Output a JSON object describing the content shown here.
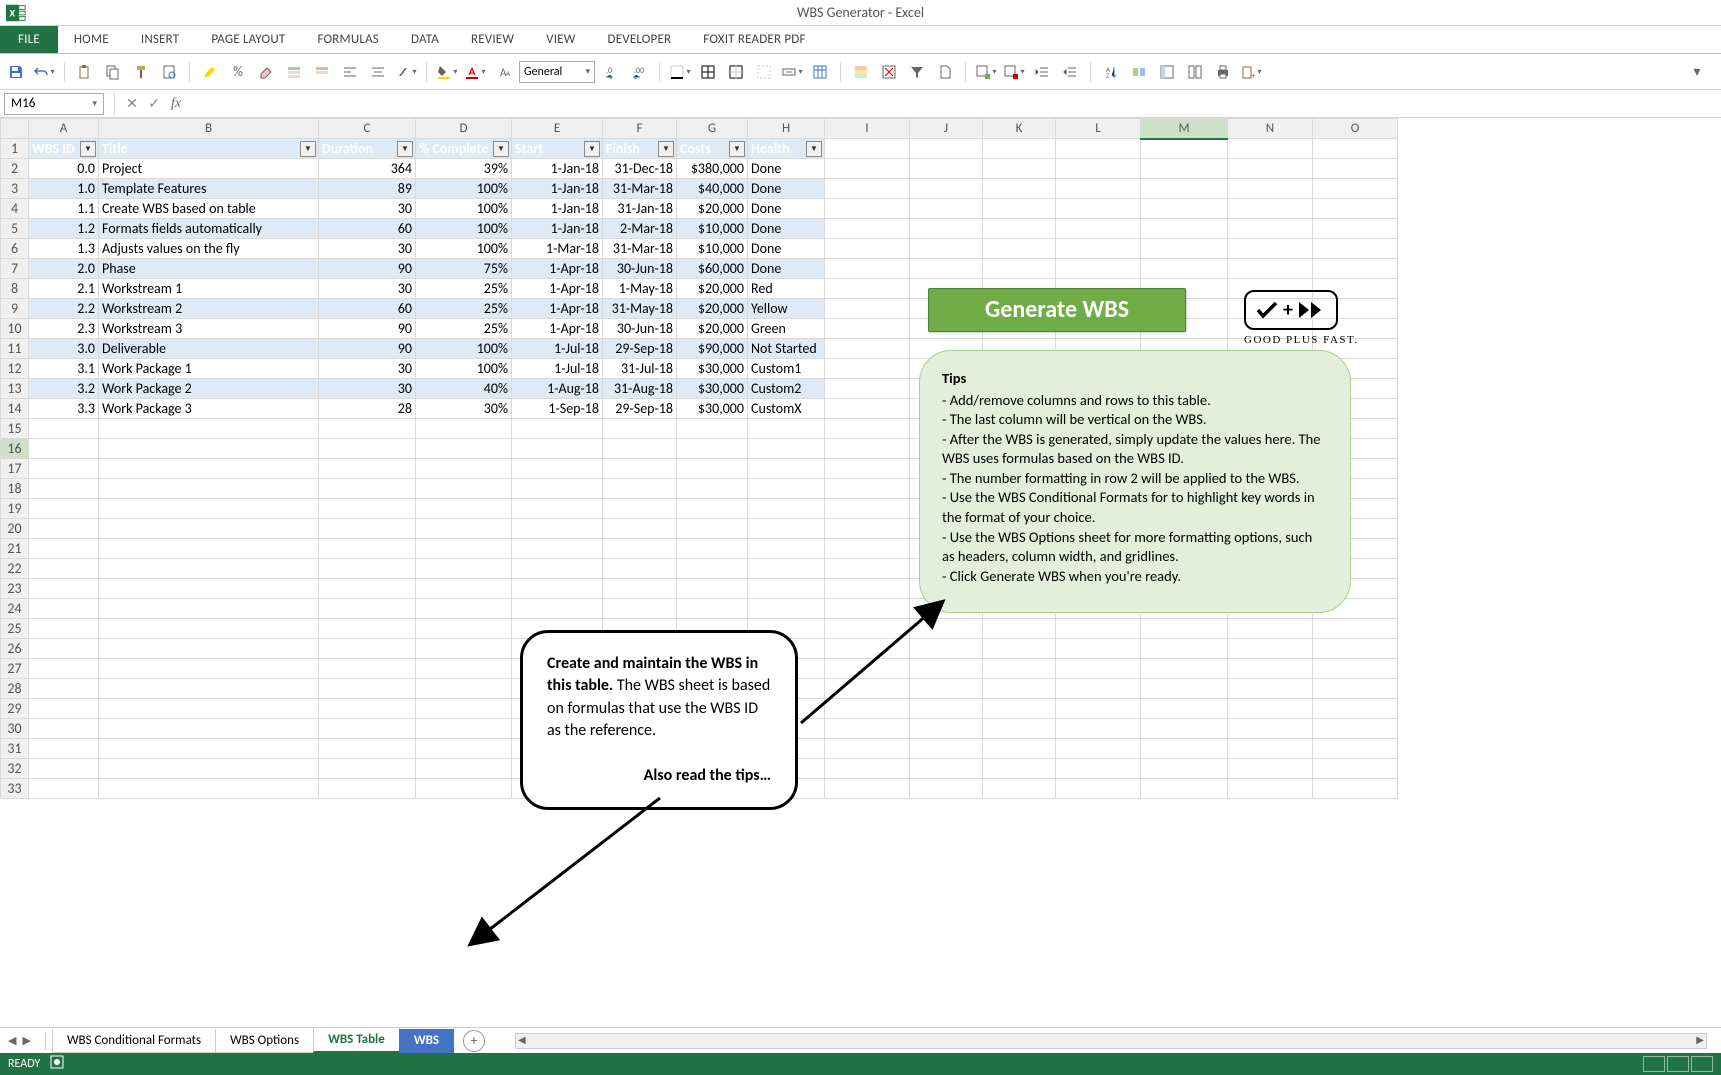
{
  "title": "WBS Generator - Excel",
  "ribbon_tabs": [
    "FILE",
    "HOME",
    "INSERT",
    "PAGE LAYOUT",
    "FORMULAS",
    "DATA",
    "REVIEW",
    "VIEW",
    "DEVELOPER",
    "FOXIT READER PDF"
  ],
  "number_format": "General",
  "name_box": "M16",
  "col_headers": [
    "A",
    "B",
    "C",
    "D",
    "E",
    "F",
    "G",
    "H",
    "I",
    "J",
    "K",
    "L",
    "M",
    "N",
    "O"
  ],
  "row_headers_count": 33,
  "active_cell": {
    "row": 16,
    "col": "M"
  },
  "table_headers": [
    "WBS ID",
    "Title",
    "Duration",
    "% Complete",
    "Start",
    "Finish",
    "Costs",
    "Health"
  ],
  "chart_data": {
    "type": "table",
    "columns": [
      "WBS ID",
      "Title",
      "Duration",
      "% Complete",
      "Start",
      "Finish",
      "Costs",
      "Health"
    ],
    "rows": [
      {
        "id": "0.0",
        "title": "Project",
        "duration": 364,
        "pct": "39%",
        "start": "1-Jan-18",
        "finish": "31-Dec-18",
        "costs": "$380,000",
        "health": "Done"
      },
      {
        "id": "1.0",
        "title": "Template Features",
        "duration": 89,
        "pct": "100%",
        "start": "1-Jan-18",
        "finish": "31-Mar-18",
        "costs": "$40,000",
        "health": "Done"
      },
      {
        "id": "1.1",
        "title": "Create WBS based on table",
        "duration": 30,
        "pct": "100%",
        "start": "1-Jan-18",
        "finish": "31-Jan-18",
        "costs": "$20,000",
        "health": "Done"
      },
      {
        "id": "1.2",
        "title": "Formats fields automatically",
        "duration": 60,
        "pct": "100%",
        "start": "1-Jan-18",
        "finish": "2-Mar-18",
        "costs": "$10,000",
        "health": "Done"
      },
      {
        "id": "1.3",
        "title": "Adjusts values on the fly",
        "duration": 30,
        "pct": "100%",
        "start": "1-Mar-18",
        "finish": "31-Mar-18",
        "costs": "$10,000",
        "health": "Done"
      },
      {
        "id": "2.0",
        "title": "Phase",
        "duration": 90,
        "pct": "75%",
        "start": "1-Apr-18",
        "finish": "30-Jun-18",
        "costs": "$60,000",
        "health": "Done"
      },
      {
        "id": "2.1",
        "title": "Workstream 1",
        "duration": 30,
        "pct": "25%",
        "start": "1-Apr-18",
        "finish": "1-May-18",
        "costs": "$20,000",
        "health": "Red"
      },
      {
        "id": "2.2",
        "title": "Workstream 2",
        "duration": 60,
        "pct": "25%",
        "start": "1-Apr-18",
        "finish": "31-May-18",
        "costs": "$20,000",
        "health": "Yellow"
      },
      {
        "id": "2.3",
        "title": "Workstream 3",
        "duration": 90,
        "pct": "25%",
        "start": "1-Apr-18",
        "finish": "30-Jun-18",
        "costs": "$20,000",
        "health": "Green"
      },
      {
        "id": "3.0",
        "title": "Deliverable",
        "duration": 90,
        "pct": "100%",
        "start": "1-Jul-18",
        "finish": "29-Sep-18",
        "costs": "$90,000",
        "health": "Not Started"
      },
      {
        "id": "3.1",
        "title": "Work Package 1",
        "duration": 30,
        "pct": "100%",
        "start": "1-Jul-18",
        "finish": "31-Jul-18",
        "costs": "$30,000",
        "health": "Custom1"
      },
      {
        "id": "3.2",
        "title": "Work Package 2",
        "duration": 30,
        "pct": "40%",
        "start": "1-Aug-18",
        "finish": "31-Aug-18",
        "costs": "$30,000",
        "health": "Custom2"
      },
      {
        "id": "3.3",
        "title": "Work Package 3",
        "duration": 28,
        "pct": "30%",
        "start": "1-Sep-18",
        "finish": "29-Sep-18",
        "costs": "$30,000",
        "health": "CustomX"
      }
    ]
  },
  "generate_button": "Generate WBS",
  "gpf_text": "GOOD PLUS FAST.",
  "tips": {
    "title": "Tips",
    "lines": [
      "- Add/remove columns and rows to this table.",
      "- The last column will be vertical on the WBS.",
      "- After the WBS is generated, simply update the values here. The WBS uses formulas based on the WBS ID.",
      "- The number formatting in row 2 will be applied to the WBS.",
      "- Use the WBS Conditional Formats for to highlight key words in the format of your choice.",
      "- Use the WBS Options sheet for more formatting options, such as headers, column width, and gridlines.",
      "- Click Generate WBS when you're ready."
    ]
  },
  "callout": {
    "bold": "Create and maintain the WBS in this table.",
    "rest": " The WBS sheet is based on formulas that use the WBS ID as the reference.",
    "also": "Also read the tips…"
  },
  "sheet_tabs": [
    "WBS Conditional Formats",
    "WBS Options",
    "WBS Table",
    "WBS"
  ],
  "active_sheet": "WBS Table",
  "status": "READY"
}
